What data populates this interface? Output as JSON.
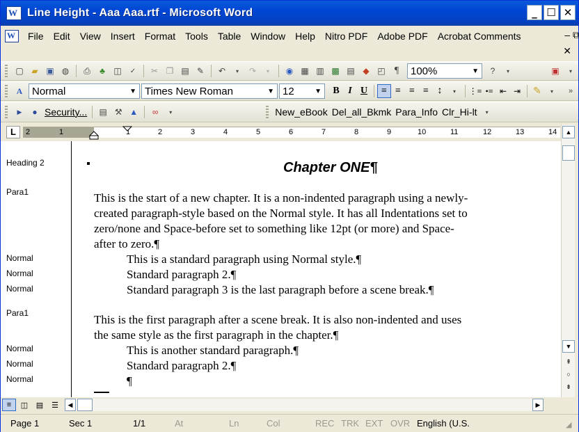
{
  "window": {
    "title": "Line Height - Aaa Aaa.rtf - Microsoft Word",
    "minimize": "_",
    "maximize": "☐",
    "close": "✕"
  },
  "menu": {
    "items": [
      "File",
      "Edit",
      "View",
      "Insert",
      "Format",
      "Tools",
      "Table",
      "Window",
      "Help",
      "Nitro PDF",
      "Adobe PDF",
      "Acrobat Comments"
    ],
    "doc_minimize": "–",
    "doc_restore": "⧉",
    "doc_close": "✕"
  },
  "standard_toolbar": {
    "zoom": "100%"
  },
  "formatting_toolbar": {
    "style": "Normal",
    "font": "Times New Roman",
    "size": "12",
    "bold": "B",
    "italic": "I",
    "underline": "U"
  },
  "toolbar3": {
    "security": "Security...",
    "macros": [
      "New_eBook",
      "Del_all_Bkmk",
      "Para_Info",
      "Clr_Hi-lt"
    ]
  },
  "ruler": {
    "tab_selector": "L",
    "numbers_left": [
      "2",
      "1"
    ],
    "numbers_right": [
      "1",
      "2",
      "3",
      "4",
      "5",
      "6",
      "7",
      "8",
      "9",
      "10",
      "11",
      "12",
      "13",
      "14"
    ]
  },
  "document": {
    "style_labels": [
      "Heading 2",
      "Para1",
      "Normal",
      "Normal",
      "Normal",
      "Para1",
      "Normal",
      "Normal",
      "Normal"
    ],
    "heading": "Chapter ONE¶",
    "lines": [
      "This is the start of a new chapter. It is a non-indented paragraph using a newly-",
      "created paragraph-style based on the Normal style. It has all Indentations set to",
      "zero/none and Space-before set to something like 12pt (or more) and Space-",
      "after to zero.¶",
      "This is a standard paragraph using Normal style.¶",
      "Standard paragraph 2.¶",
      "Standard paragraph 3 is the last paragraph before a scene break.¶",
      "This is the first paragraph after a scene break. It is also non-indented and uses",
      "the same style as the first paragraph in the chapter.¶",
      "This is another standard paragraph.¶",
      "Standard paragraph 2.¶",
      "¶"
    ]
  },
  "status": {
    "page": "Page 1",
    "sec": "Sec 1",
    "pages": "1/1",
    "at": "At",
    "ln": "Ln",
    "col": "Col",
    "rec": "REC",
    "trk": "TRK",
    "ext": "EXT",
    "ovr": "OVR",
    "language": "English (U.S."
  }
}
